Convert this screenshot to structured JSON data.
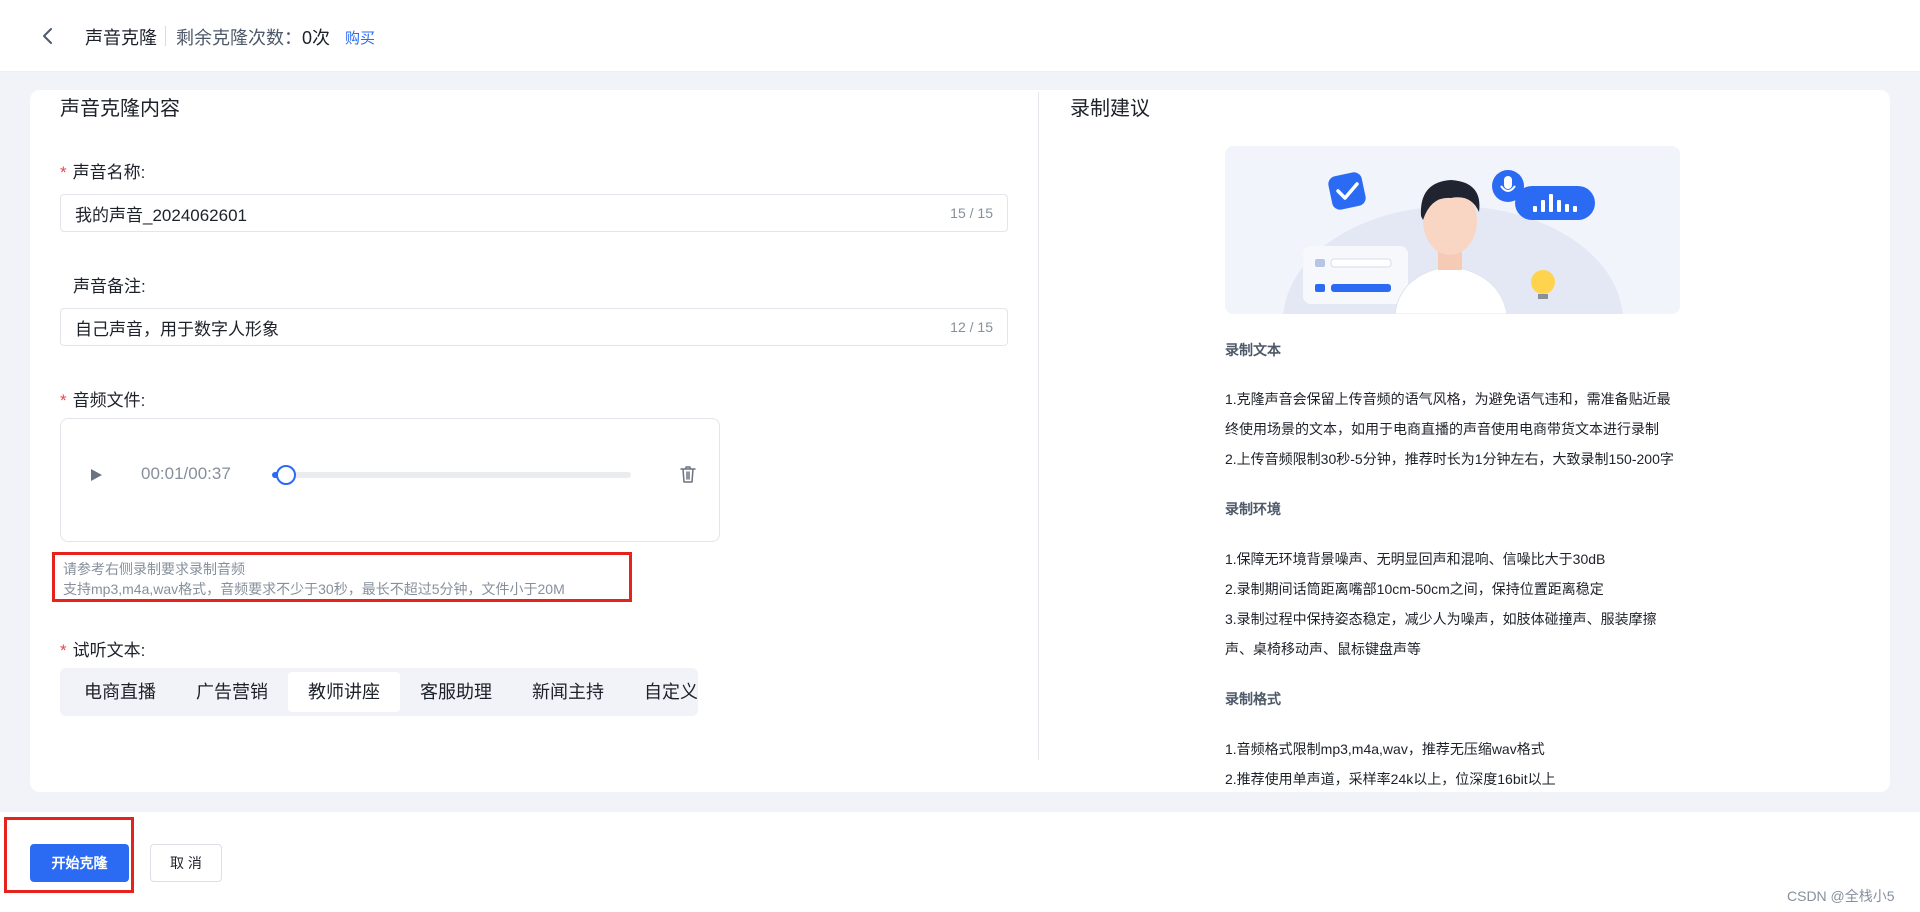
{
  "header": {
    "title": "声音克隆",
    "remain_label": "剩余克隆次数：",
    "remain_value": "0次",
    "buy_link": "购买"
  },
  "form": {
    "section_title": "声音克隆内容",
    "name_label": "声音名称:",
    "name_value": "我的声音_2024062601",
    "name_count": "15 / 15",
    "note_label": "声音备注:",
    "note_value": "自己声音，用于数字人形象",
    "note_count": "12 / 15",
    "audio_label": "音频文件:",
    "audio": {
      "time": "00:01/00:37",
      "progress": 0.027
    },
    "hint_line1": "请参考右侧录制要求录制音频",
    "hint_line2": "支持mp3,m4a,wav格式，音频要求不少于30秒，最长不超过5分钟，文件小于20M",
    "preview_label": "试听文本:",
    "tabs": [
      {
        "label": "电商直播",
        "active": false
      },
      {
        "label": "广告营销",
        "active": false
      },
      {
        "label": "教师讲座",
        "active": true
      },
      {
        "label": "客服助理",
        "active": false
      },
      {
        "label": "新闻主持",
        "active": false
      },
      {
        "label": "自定义",
        "active": false
      }
    ]
  },
  "tips": {
    "section_title": "录制建议",
    "text_heading": "录制文本",
    "text_1a": "1.克隆声音会保留上传音频的语气风格，为避免语气违和，需准备贴近最",
    "text_1b": "终使用场景的文本，如用于电商直播的声音使用电商带货文本进行录制",
    "text_2": "2.上传音频限制30秒-5分钟，推荐时长为1分钟左右，大致录制150-200字",
    "env_heading": "录制环境",
    "env_1": "1.保障无环境背景噪声、无明显回声和混响、信噪比大于30dB",
    "env_2": "2.录制期间话筒距离嘴部10cm-50cm之间，保持位置距离稳定",
    "env_3a": "3.录制过程中保持姿态稳定，减少人为噪声，如肢体碰撞声、服装摩擦",
    "env_3b": "声、桌椅移动声、鼠标键盘声等",
    "format_heading": "录制格式",
    "format_1": "1.音频格式限制mp3,m4a,wav，推荐无压缩wav格式",
    "format_2": "2.推荐使用单声道，采样率24k以上，位深度16bit以上"
  },
  "footer": {
    "start_button": "开始克隆",
    "cancel_button": "取 消"
  },
  "watermark": "CSDN @全栈小5",
  "colors": {
    "accent": "#2b6bf3",
    "required": "#e5484d",
    "highlight": "#e5231c"
  }
}
